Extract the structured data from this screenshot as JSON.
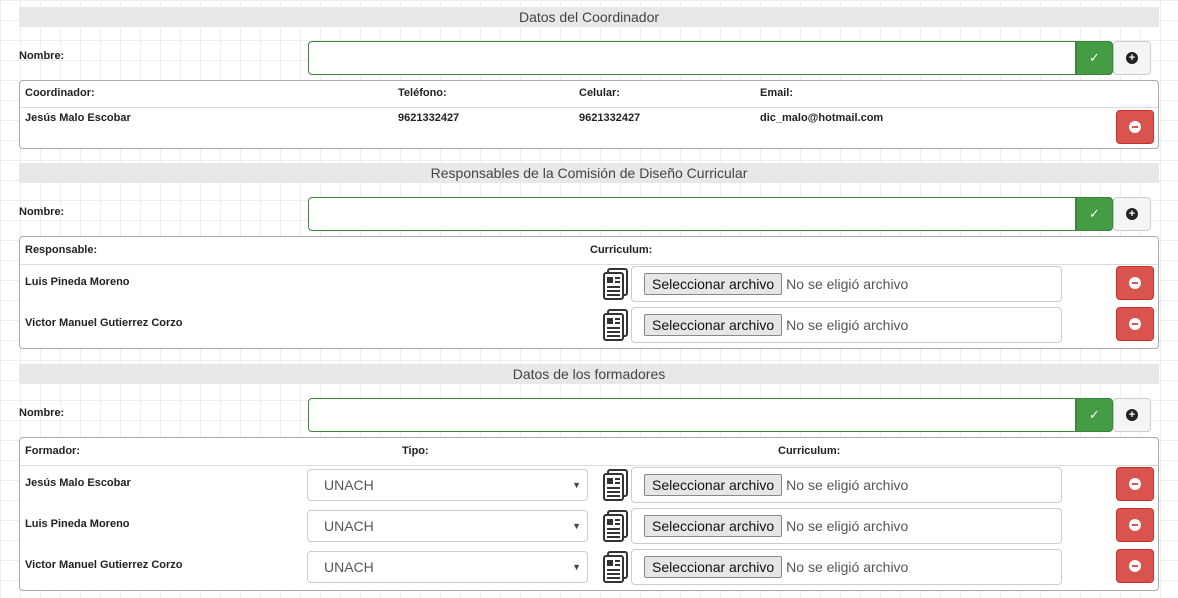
{
  "coordinator": {
    "header": "Datos del Coordinador",
    "name_label": "Nombre:",
    "name_value": "",
    "columns": [
      "Coordinador:",
      "Teléfono:",
      "Celular:",
      "Email:"
    ],
    "row": {
      "name": "Jesús Malo Escobar",
      "phone": "9621332427",
      "cell": "9621332427",
      "email": "dic_malo@hotmail.com"
    }
  },
  "committee": {
    "header": "Responsables de la Comisión de Diseño Curricular",
    "name_label": "Nombre:",
    "name_value": "",
    "columns": [
      "Responsable:",
      "Curriculum:"
    ],
    "rows": [
      {
        "name": "Luis Pineda Moreno",
        "file_button": "Seleccionar archivo",
        "file_status": "No se eligió archivo"
      },
      {
        "name": "Victor Manuel Gutierrez Corzo",
        "file_button": "Seleccionar archivo",
        "file_status": "No se eligió archivo"
      }
    ]
  },
  "trainers": {
    "header": "Datos de los formadores",
    "name_label": "Nombre:",
    "name_value": "",
    "columns": [
      "Formador:",
      "Tipo:",
      "Curriculum:"
    ],
    "rows": [
      {
        "name": "Jesús Malo Escobar",
        "type": "UNACH",
        "file_button": "Seleccionar archivo",
        "file_status": "No se eligió archivo"
      },
      {
        "name": "Luis Pineda Moreno",
        "type": "UNACH",
        "file_button": "Seleccionar archivo",
        "file_status": "No se eligió archivo"
      },
      {
        "name": "Victor Manuel Gutierrez Corzo",
        "type": "UNACH",
        "file_button": "Seleccionar archivo",
        "file_status": "No se eligió archivo"
      }
    ]
  },
  "icons": {
    "confirm": "check-icon",
    "add": "plus-circle-icon",
    "remove": "minus-circle-icon",
    "document": "document-icon"
  },
  "colors": {
    "confirm": "#449d44",
    "remove": "#d9534f",
    "input_border": "#3c8a3c"
  }
}
